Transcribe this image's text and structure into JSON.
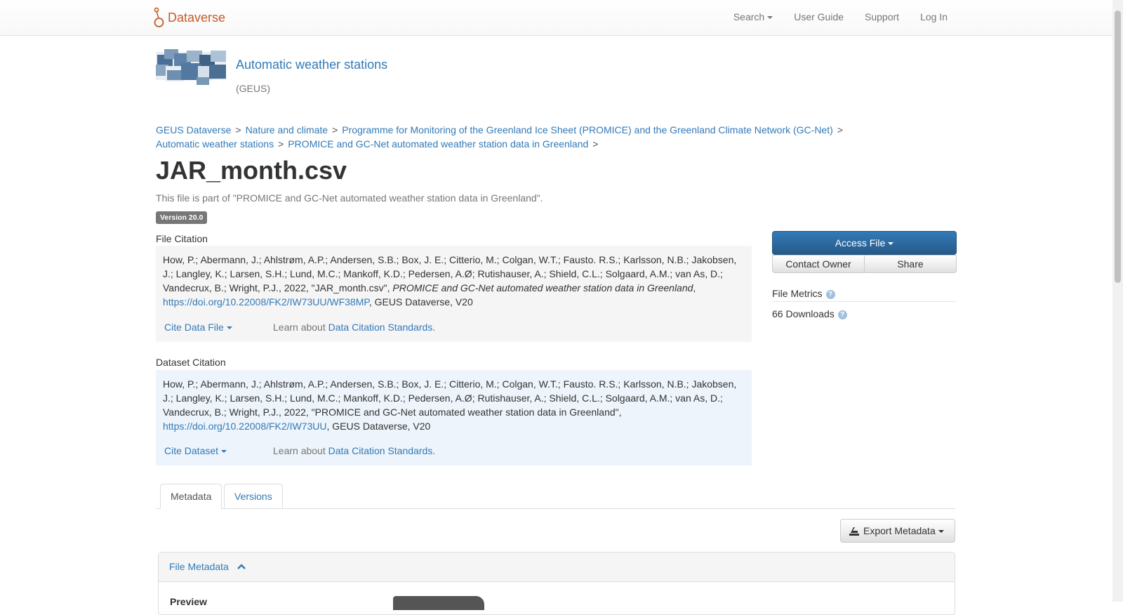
{
  "navbar": {
    "brand": "Dataverse",
    "items": [
      {
        "label": "Search",
        "dropdown": true
      },
      {
        "label": "User Guide"
      },
      {
        "label": "Support"
      },
      {
        "label": "Log In"
      }
    ]
  },
  "dataverse": {
    "title": "Automatic weather stations",
    "affiliation": "(GEUS)"
  },
  "breadcrumb": [
    "GEUS Dataverse",
    "Nature and climate",
    "Programme for Monitoring of the Greenland Ice Sheet (PROMICE) and the Greenland Climate Network (GC-Net)",
    "Automatic weather stations",
    "PROMICE and GC-Net automated weather station data in Greenland"
  ],
  "breadcrumb_separator": ">",
  "file": {
    "title": "JAR_month.csv",
    "subtitle": "This file is part of \"PROMICE and GC-Net automated weather station data in Greenland\".",
    "version": "Version 20.0"
  },
  "file_citation": {
    "label": "File Citation",
    "authors": "How, P.; Abermann, J.; Ahlstrøm, A.P.; Andersen, S.B.; Box, J. E.; Citterio, M.; Colgan, W.T.; Fausto. R.S.; Karlsson, N.B.; Jakobsen, J.; Langley, K.; Larsen, S.H.; Lund, M.C.; Mankoff, K.D.; Pedersen, A.Ø; Rutishauser, A.; Shield, C.L.; Solgaard, A.M.; van As, D.; Vandecrux, B.; Wright, P.J., 2022, \"JAR_month.csv\", ",
    "dataset_italic": "PROMICE and GC-Net automated weather station data in Greenland",
    "comma": ", ",
    "doi": "https://doi.org/10.22008/FK2/IW73UU/WF38MP",
    "suffix": ", GEUS Dataverse, V20",
    "cite_button": "Cite Data File",
    "learn_prefix": "Learn about",
    "learn_link": "Data Citation Standards."
  },
  "dataset_citation": {
    "label": "Dataset Citation",
    "text": "How, P.; Abermann, J.; Ahlstrøm, A.P.; Andersen, S.B.; Box, J. E.; Citterio, M.; Colgan, W.T.; Fausto. R.S.; Karlsson, N.B.; Jakobsen, J.; Langley, K.; Larsen, S.H.; Lund, M.C.; Mankoff, K.D.; Pedersen, A.Ø; Rutishauser, A.; Shield, C.L.; Solgaard, A.M.; van As, D.; Vandecrux, B.; Wright, P.J., 2022, \"PROMICE and GC-Net automated weather station data in Greenland\", ",
    "doi": "https://doi.org/10.22008/FK2/IW73UU",
    "suffix": ", GEUS Dataverse, V20",
    "cite_button": "Cite Dataset",
    "learn_prefix": "Learn about",
    "learn_link": "Data Citation Standards."
  },
  "actions": {
    "access_file": "Access File",
    "contact_owner": "Contact Owner",
    "share": "Share"
  },
  "metrics": {
    "title": "File Metrics",
    "downloads": "66 Downloads"
  },
  "tabs": [
    {
      "label": "Metadata",
      "active": true
    },
    {
      "label": "Versions",
      "active": false
    }
  ],
  "export_metadata": "Export Metadata",
  "file_metadata": {
    "title": "File Metadata",
    "preview_label": "Preview"
  },
  "colors": {
    "brand": "#c55b28",
    "link": "#337ab7",
    "primary": "#2a6aa5"
  }
}
